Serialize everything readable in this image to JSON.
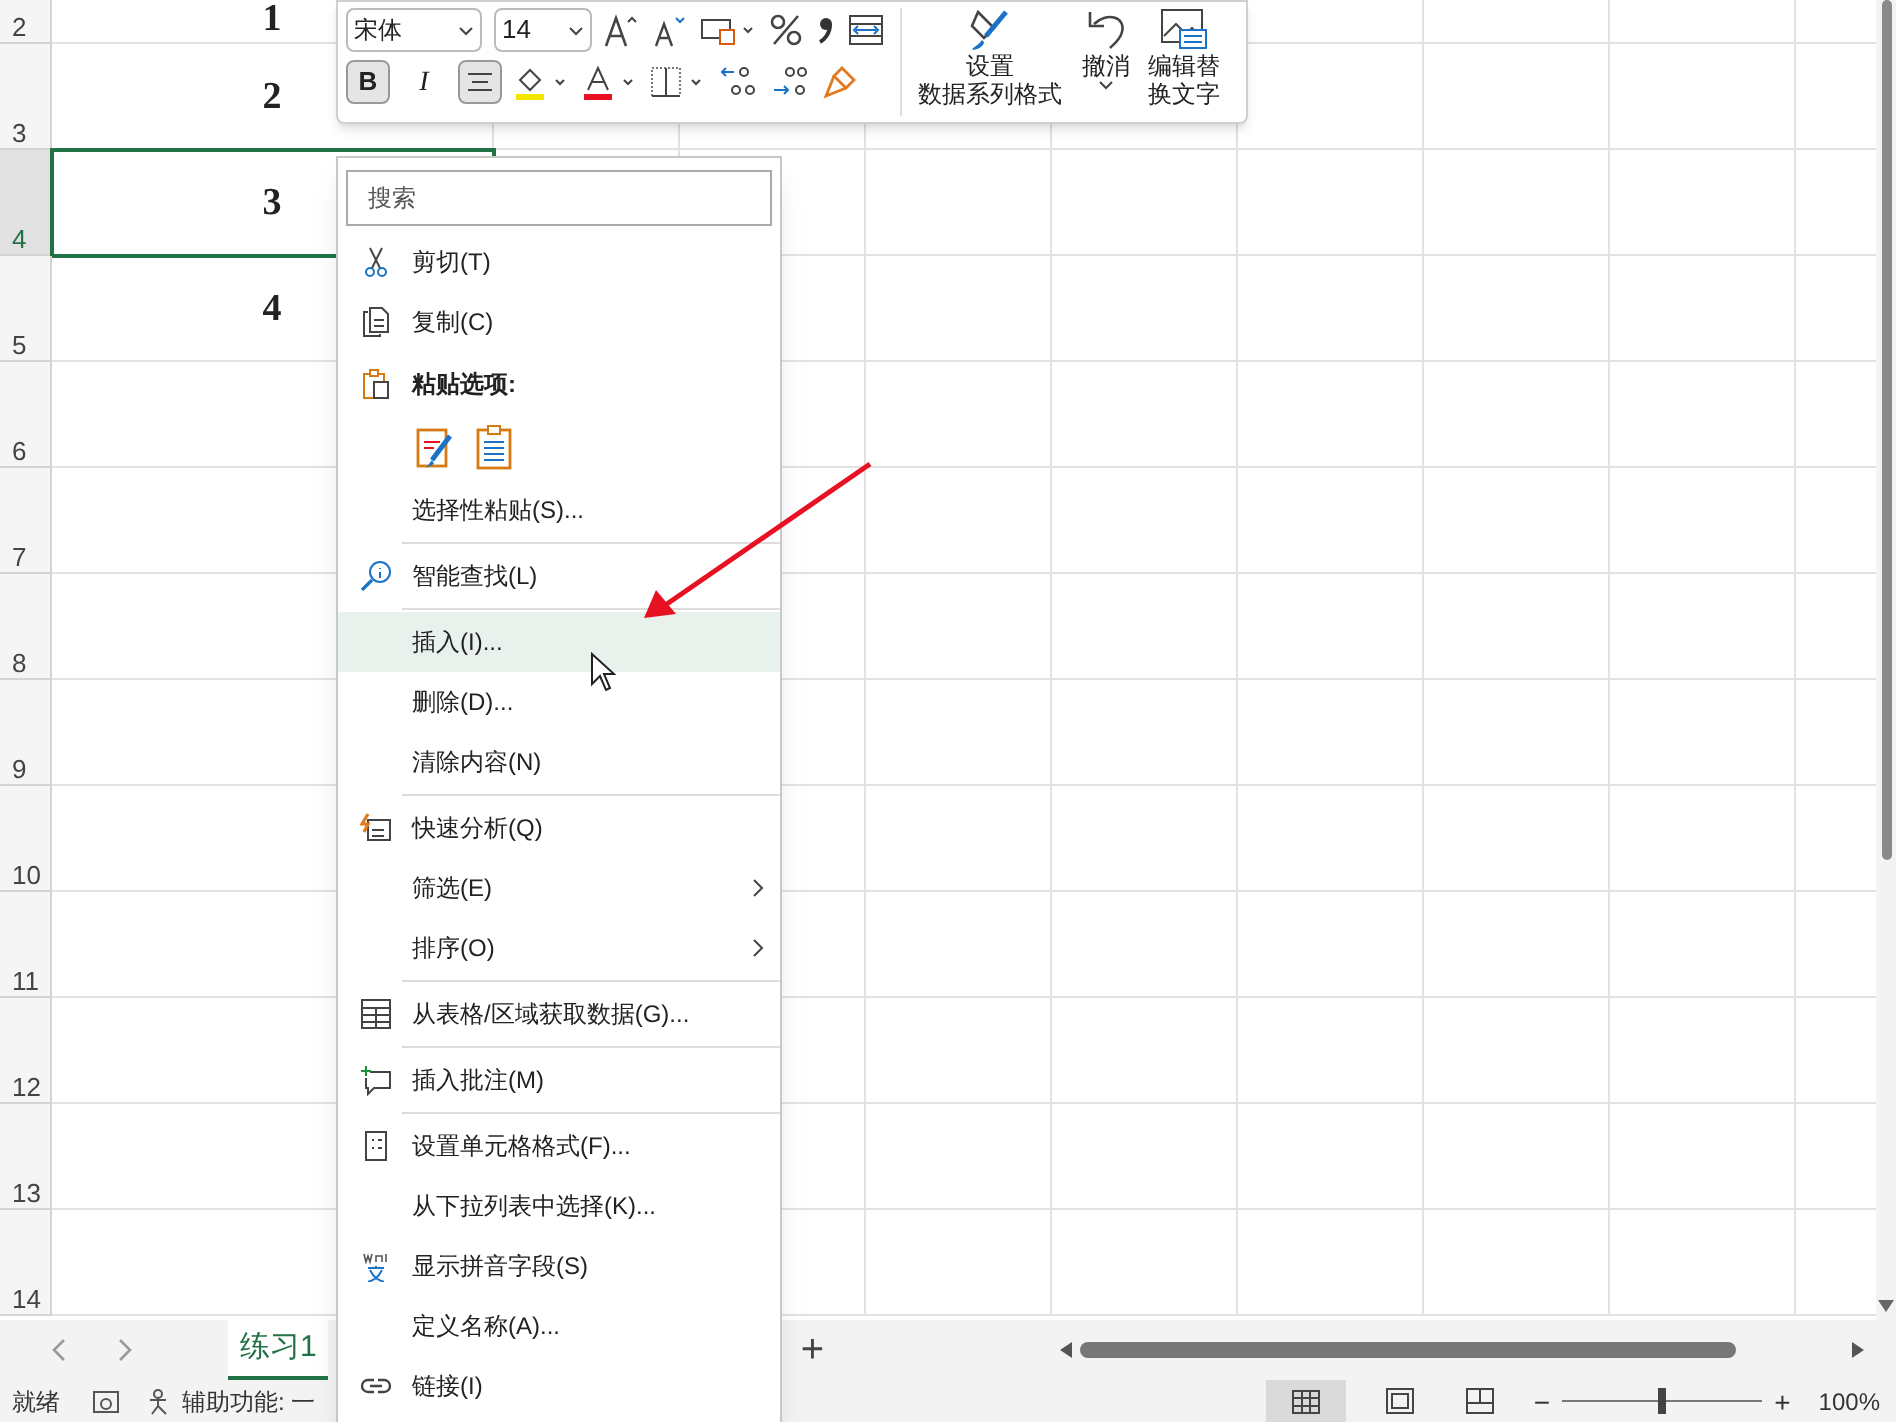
{
  "sheet": {
    "rows": [
      {
        "header": "2",
        "value": "1",
        "selected": false
      },
      {
        "header": "3",
        "value": "2",
        "selected": false
      },
      {
        "header": "4",
        "value": "3",
        "selected": true
      },
      {
        "header": "5",
        "value": "4",
        "selected": false
      },
      {
        "header": "6",
        "selected": false
      },
      {
        "header": "7",
        "selected": false
      },
      {
        "header": "8",
        "selected": false
      },
      {
        "header": "9",
        "selected": false
      },
      {
        "header": "10",
        "selected": false
      },
      {
        "header": "11",
        "selected": false
      },
      {
        "header": "12",
        "selected": false
      },
      {
        "header": "13",
        "selected": false
      },
      {
        "header": "14",
        "selected": false
      }
    ]
  },
  "mini_toolbar": {
    "font": "宋体",
    "size": "14",
    "bold": {
      "label": "B",
      "on": true
    },
    "italic": {
      "label": "I",
      "on": false
    },
    "align_on": true,
    "format_series": [
      "设置",
      "数据系列格式"
    ],
    "undo": "撤消",
    "alt_text": [
      "编辑替",
      "换文字"
    ]
  },
  "context_menu": {
    "search": {
      "placeholder": "搜索"
    },
    "items": [
      {
        "kind": "item",
        "label": "剪切(T)",
        "highlighted": false,
        "submenu": false
      },
      {
        "kind": "item",
        "label": "复制(C)",
        "highlighted": false,
        "submenu": false
      },
      {
        "kind": "heading",
        "label": "粘贴选项:"
      },
      {
        "kind": "paste_options"
      },
      {
        "kind": "item",
        "label": "选择性粘贴(S)...",
        "highlighted": false,
        "submenu": false
      },
      {
        "kind": "separator"
      },
      {
        "kind": "item",
        "label": "智能查找(L)",
        "highlighted": false,
        "submenu": false
      },
      {
        "kind": "separator"
      },
      {
        "kind": "item",
        "label": "插入(I)...",
        "highlighted": true,
        "submenu": false
      },
      {
        "kind": "item",
        "label": "删除(D)...",
        "highlighted": false,
        "submenu": false
      },
      {
        "kind": "item",
        "label": "清除内容(N)",
        "highlighted": false,
        "submenu": false
      },
      {
        "kind": "separator"
      },
      {
        "kind": "item",
        "label": "快速分析(Q)",
        "highlighted": false,
        "submenu": false
      },
      {
        "kind": "item",
        "label": "筛选(E)",
        "highlighted": false,
        "submenu": true
      },
      {
        "kind": "item",
        "label": "排序(O)",
        "highlighted": false,
        "submenu": true
      },
      {
        "kind": "separator"
      },
      {
        "kind": "item",
        "label": "从表格/区域获取数据(G)...",
        "highlighted": false,
        "submenu": false
      },
      {
        "kind": "separator"
      },
      {
        "kind": "item",
        "label": "插入批注(M)",
        "highlighted": false,
        "submenu": false
      },
      {
        "kind": "separator"
      },
      {
        "kind": "item",
        "label": "设置单元格格式(F)...",
        "highlighted": false,
        "submenu": false
      },
      {
        "kind": "item",
        "label": "从下拉列表中选择(K)...",
        "highlighted": false,
        "submenu": false
      },
      {
        "kind": "item",
        "label": "显示拼音字段(S)",
        "highlighted": false,
        "submenu": false
      },
      {
        "kind": "item",
        "label": "定义名称(A)...",
        "highlighted": false,
        "submenu": false
      },
      {
        "kind": "item",
        "label": "链接(I)",
        "highlighted": false,
        "submenu": false
      }
    ]
  },
  "sheet_tabs": {
    "tabs": [
      {
        "label": "练习1",
        "selected": true
      }
    ],
    "add": "+"
  },
  "status_bar": {
    "ready": "就绪",
    "accessibility": "辅助功能: 一",
    "zoom": {
      "level": 0.5,
      "minus": "−",
      "plus": "+",
      "reading": "100%"
    }
  }
}
